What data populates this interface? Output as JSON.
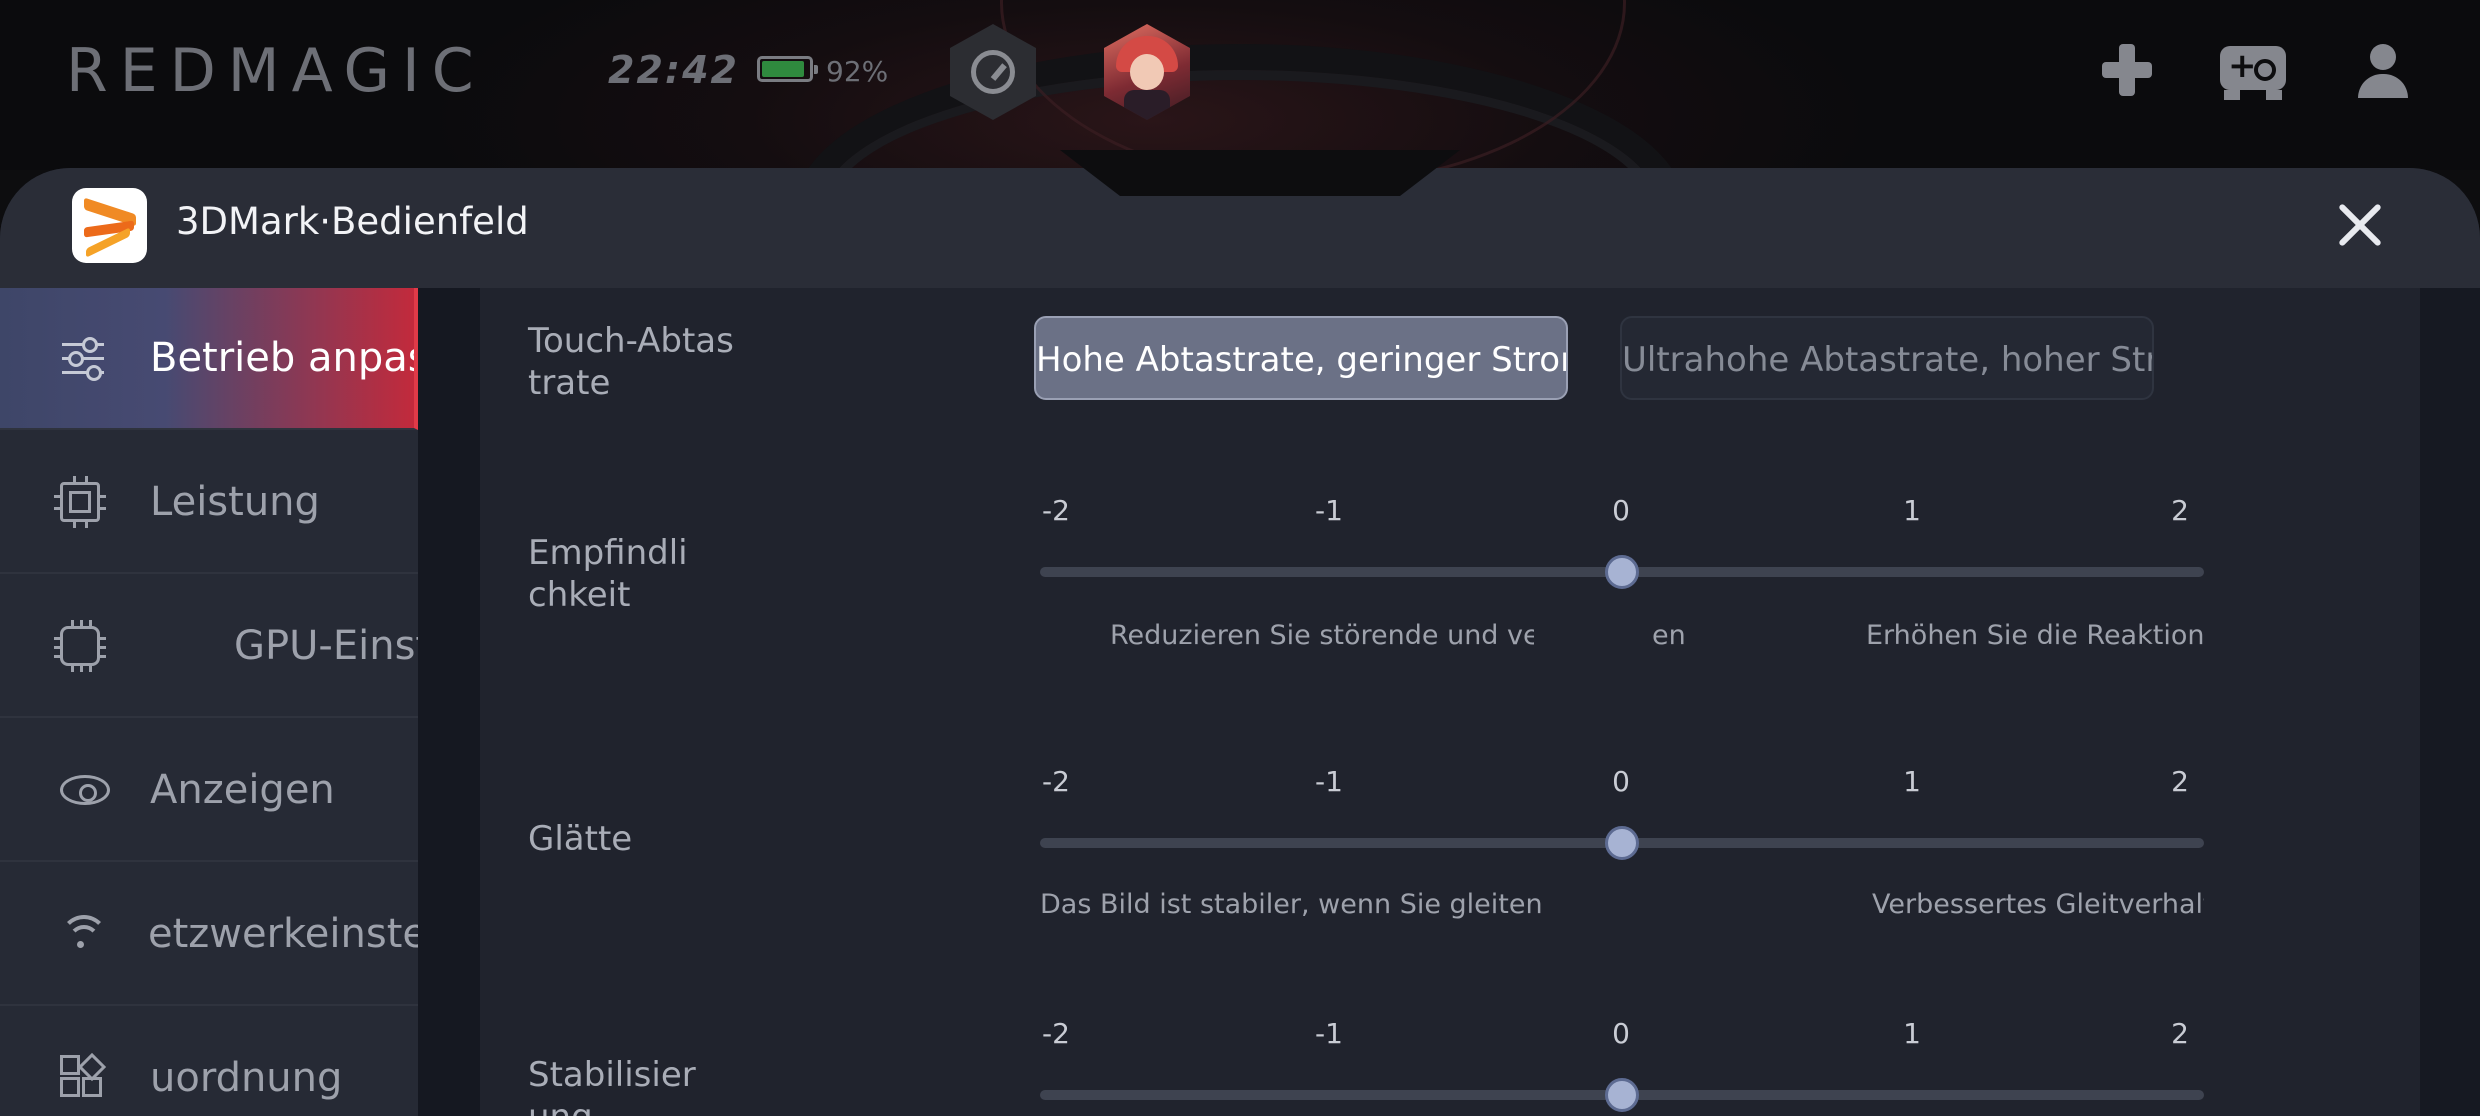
{
  "status": {
    "brand": "REDMAGIC",
    "time": "22:42",
    "battery_percent": "92%",
    "battery_level": 0.92,
    "battery_color": "#2f8a3e"
  },
  "panel": {
    "title": "3DMark·Bedienfeld",
    "app_icon": "3dmark-icon",
    "close_icon": "close-icon"
  },
  "sidebar": {
    "items": [
      {
        "label": "Betrieb anpass",
        "icon": "sliders-icon",
        "active": true
      },
      {
        "label": "Leistung",
        "icon": "chip-icon",
        "active": false
      },
      {
        "label": "GPU-Einst",
        "icon": "gpu-chip-icon",
        "active": false
      },
      {
        "label": "Anzeigen",
        "icon": "eye-icon",
        "active": false
      },
      {
        "label": "etzwerkeinstell",
        "icon": "wifi-icon",
        "active": false
      },
      {
        "label": "uordnung",
        "icon": "grid-icon",
        "active": false
      }
    ],
    "accent": "#e03a48"
  },
  "touch_sampling": {
    "label_line1": "Touch-Abtas",
    "label_line2": "trate",
    "options": [
      {
        "label": "Hohe Abtastrate, geringer Stromv",
        "selected": true
      },
      {
        "label": "Ultrahohe Abtastrate, hoher Stron",
        "selected": false
      }
    ]
  },
  "sensitivity": {
    "label_line1": "Empfindli",
    "label_line2": "chkeit",
    "ticks": [
      "-2",
      "-1",
      "0",
      "1",
      "2"
    ],
    "value": 0,
    "hint_left": "Reduzieren Sie störende und verseh",
    "hint_mid": "en",
    "hint_right": "Erhöhen Sie die Reaktions"
  },
  "smoothness": {
    "label": "Glätte",
    "ticks": [
      "-2",
      "-1",
      "0",
      "1",
      "2"
    ],
    "value": 0,
    "hint_left": "Das Bild ist stabiler, wenn Sie gleiten",
    "hint_right": "Verbessertes Gleitverhalten"
  },
  "stabilization": {
    "label_line1": "Stabilisier",
    "label_line2": "ung",
    "ticks": [
      "-2",
      "-1",
      "0",
      "1",
      "2"
    ],
    "value": 0
  },
  "top_icons": [
    "speedometer-icon",
    "character-avatar",
    "gamepad-icon",
    "controller-icon",
    "user-icon"
  ]
}
